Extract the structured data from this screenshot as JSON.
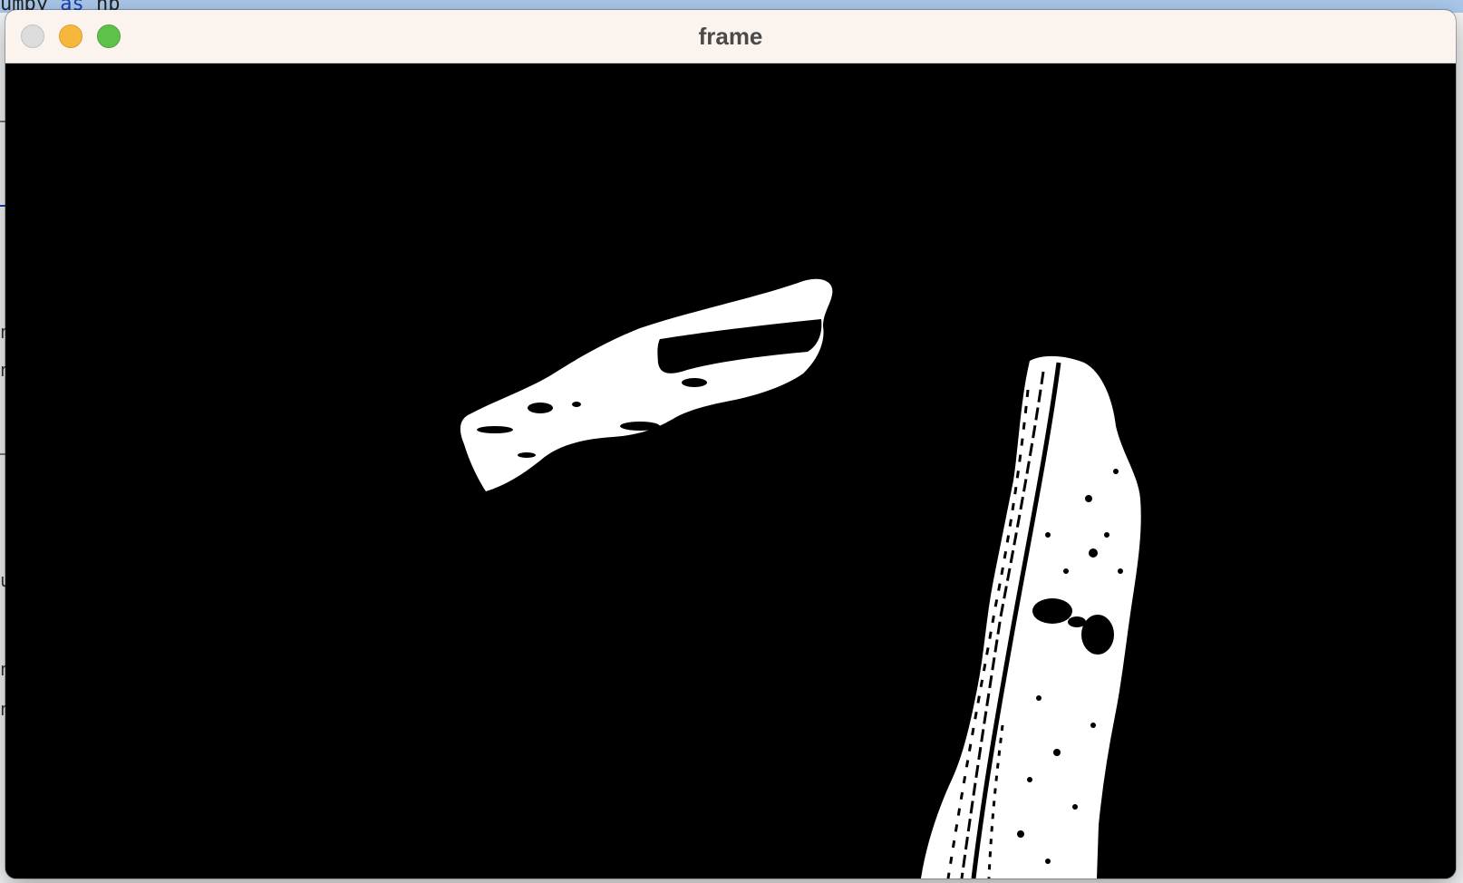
{
  "background": {
    "code_fragment_prefix": "umpy ",
    "code_fragment_keyword": "as",
    "code_fragment_suffix": " np",
    "side_glyphs": [
      "n",
      "n",
      "u",
      "n",
      "n"
    ]
  },
  "window": {
    "title": "frame",
    "buttons": {
      "close": "close-button",
      "minimize": "minimize-button",
      "maximize": "maximize-button"
    },
    "colors": {
      "titlebar": "#fbf3ee",
      "close": "#dcdcdc",
      "minimize": "#f5b83c",
      "maximize": "#5ec24a",
      "mask_background": "#000000",
      "mask_foreground": "#ffffff"
    }
  }
}
